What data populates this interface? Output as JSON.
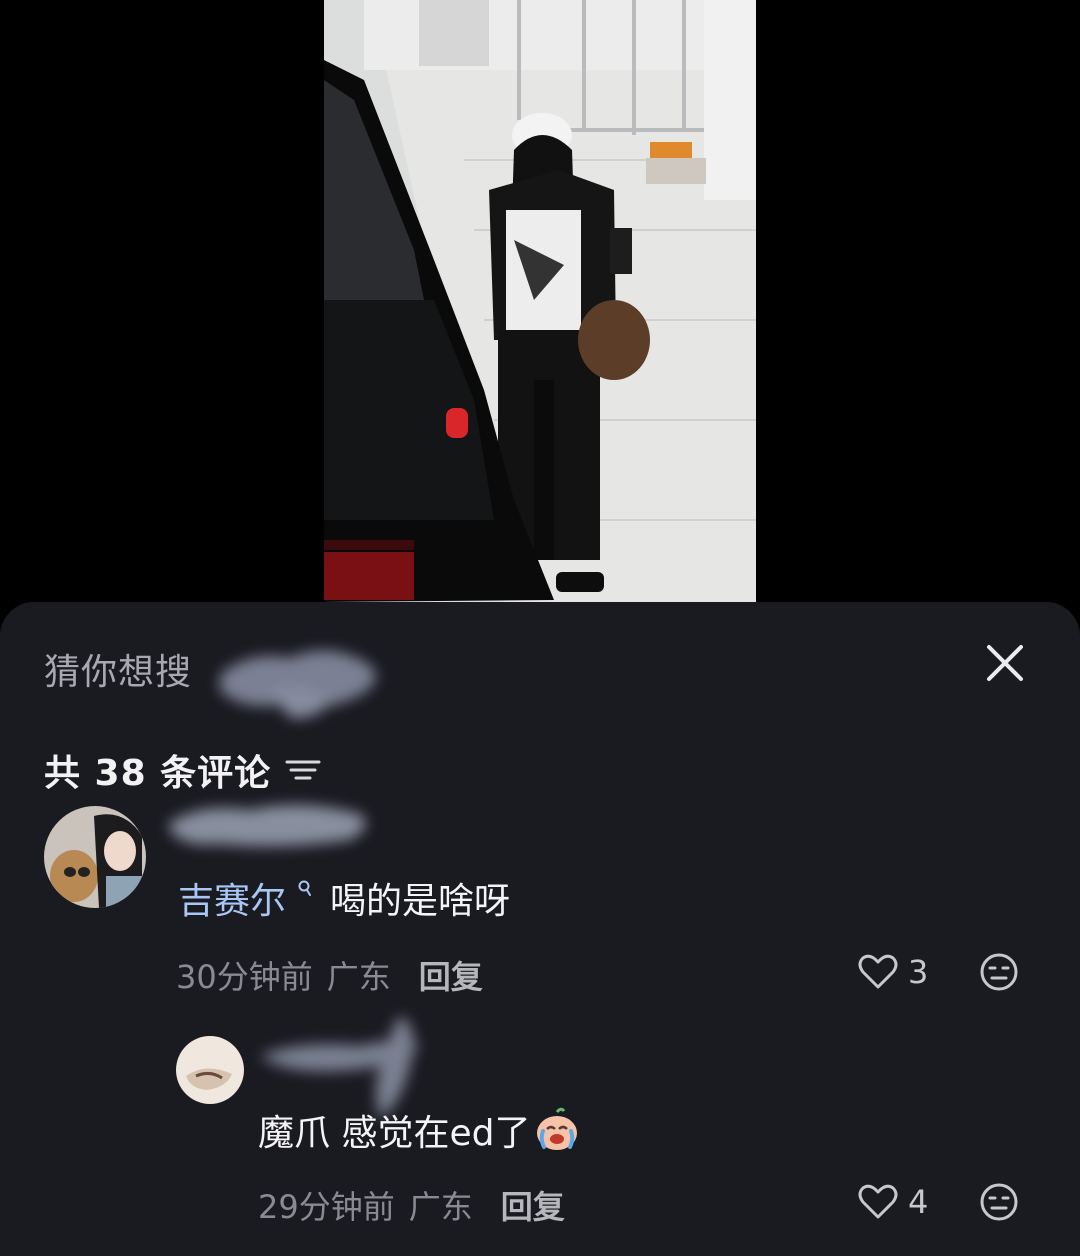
{
  "search_suggest": {
    "label": "猜你想搜"
  },
  "comments_header": {
    "count_text": "共 38 条评论"
  },
  "comments": [
    {
      "mention": "吉赛尔",
      "text": "喝的是啥呀",
      "time": "30分钟前",
      "location": "广东",
      "reply_label": "回复",
      "likes": "3"
    },
    {
      "text": "魔爪 感觉在ed了",
      "time": "29分钟前",
      "location": "广东",
      "reply_label": "回复",
      "likes": "4"
    }
  ],
  "colors": {
    "sheet_bg": "#1a1a21",
    "mention": "#a9c7f5",
    "secondary_text": "#8a8a92"
  }
}
